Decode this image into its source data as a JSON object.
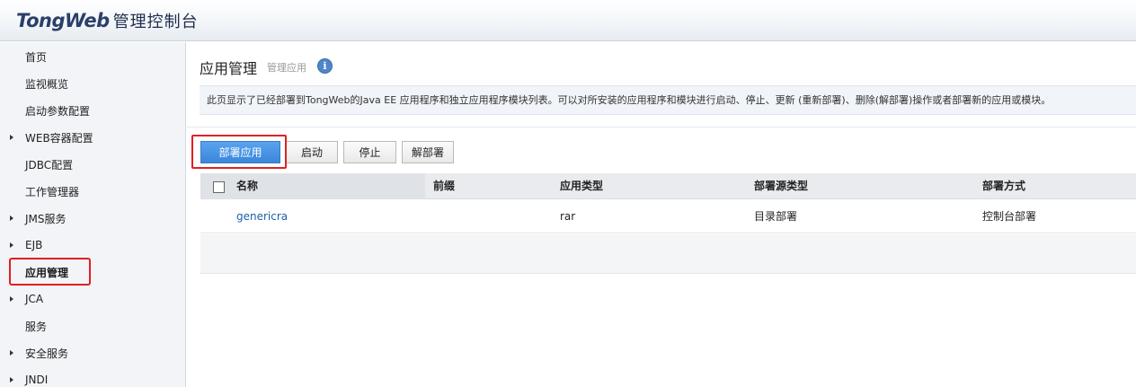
{
  "header": {
    "logo_brand_a": "Tong",
    "logo_brand_b": "Web",
    "logo_title": "管理控制台"
  },
  "sidebar": {
    "items": [
      {
        "label": "首页",
        "has_arrow": false
      },
      {
        "label": "监视概览",
        "has_arrow": false
      },
      {
        "label": "启动参数配置",
        "has_arrow": false
      },
      {
        "label": "WEB容器配置",
        "has_arrow": true
      },
      {
        "label": "JDBC配置",
        "has_arrow": false
      },
      {
        "label": "工作管理器",
        "has_arrow": false
      },
      {
        "label": "JMS服务",
        "has_arrow": true
      },
      {
        "label": "EJB",
        "has_arrow": true
      },
      {
        "label": "应用管理",
        "has_arrow": false,
        "active": true
      },
      {
        "label": "JCA",
        "has_arrow": true
      },
      {
        "label": "服务",
        "has_arrow": false
      },
      {
        "label": "安全服务",
        "has_arrow": true
      },
      {
        "label": "JNDI",
        "has_arrow": true
      }
    ]
  },
  "main": {
    "title": "应用管理",
    "subtitle": "管理应用",
    "info_icon": "info-icon",
    "description": "此页显示了已经部署到TongWeb的Java EE 应用程序和独立应用程序模块列表。可以对所安装的应用程序和模块进行启动、停止、更新 (重新部署)、删除(解部署)操作或者部署新的应用或模块。",
    "buttons": {
      "deploy": "部署应用",
      "start": "启动",
      "stop": "停止",
      "undeploy": "解部署"
    },
    "table": {
      "columns": [
        "名称",
        "前缀",
        "应用类型",
        "部署源类型",
        "部署方式"
      ],
      "rows": [
        {
          "name": "genericra",
          "prefix": "",
          "type": "rar",
          "source_type": "目录部署",
          "method": "控制台部署"
        }
      ]
    }
  },
  "colors": {
    "primary_button": "#3a86dc",
    "highlight_box": "#e02020",
    "link": "#1f5fa8"
  }
}
